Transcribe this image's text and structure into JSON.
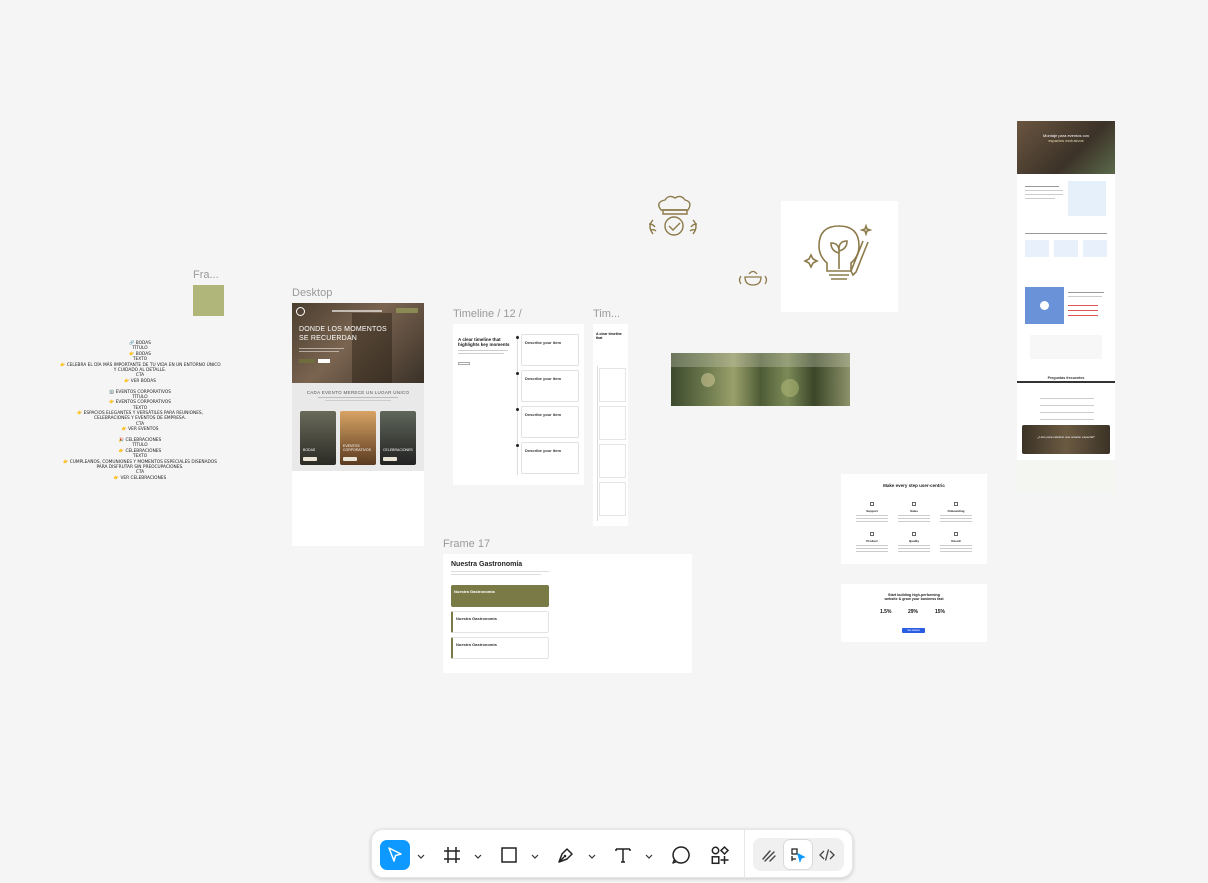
{
  "frames": {
    "small_frame_label": "Fra...",
    "desktop_label": "Desktop",
    "timeline_label": "Timeline / 12 /",
    "timeline_small_label": "Tim...",
    "frame17_label": "Frame 17"
  },
  "outline_text": [
    "🔗 BODAS",
    "TÍTULO",
    "👉 BODAS",
    "TEXTO",
    "👉 CELEBRA EL DÍA MÁS IMPORTANTE DE TU VIDA EN UN ENTORNO ÚNICO",
    "Y CUIDADO AL DETALLE.",
    "CTA",
    "👉 VER BODAS",
    "",
    "🏢 EVENTOS CORPORATIVOS",
    "TÍTULO",
    "👉 EVENTOS CORPORATIVOS",
    "TEXTO",
    "👉 ESPACIOS ELEGANTES Y VERSÁTILES PARA REUNIONES,",
    "CELEBRACIONES Y EVENTOS DE EMPRESA.",
    "CTA",
    "👉 VER EVENTOS",
    "",
    "🎉 CELEBRACIONES",
    "TÍTULO",
    "👉 CELEBRACIONES",
    "TEXTO",
    "👉 CUMPLEAÑOS, COMUNIONES Y MOMENTOS ESPECIALES DISEÑADOS",
    "PARA DISFRUTAR SIN PREOCUPACIONES.",
    "CTA",
    "👉 VER CELEBRACIONES"
  ],
  "desktop": {
    "hero_title_line1": "DONDE LOS MOMENTOS",
    "hero_title_line2": "SE RECUERDAN",
    "section_title": "CADA EVENTO MERECE UN LUGAR ÚNICO",
    "cards": [
      {
        "label": "BODAS"
      },
      {
        "label": "EVENTOS CORPORATIVOS"
      },
      {
        "label": "CELEBRACIONES"
      }
    ]
  },
  "timeline": {
    "heading_line1": "A clear timeline that",
    "heading_line2": "highlights key moments",
    "items": [
      {
        "title": "Describe your item"
      },
      {
        "title": "Describe your item"
      },
      {
        "title": "Describe your item"
      },
      {
        "title": "Describe your item"
      }
    ]
  },
  "gastronomia": {
    "title": "Nuestra Gastronomía",
    "cards": [
      {
        "title": "Nuestra Gastronomía"
      },
      {
        "title": "Nuestra Gastronomía"
      },
      {
        "title": "Nuestra Gastronomía"
      }
    ]
  },
  "user_centric": {
    "title": "Make every step user-centric",
    "items": [
      "Support",
      "Sales",
      "Onboarding",
      "Product",
      "Quality",
      "Result"
    ]
  },
  "stats": {
    "title_line1": "Start building high-performing",
    "title_line2": "website & grow your business fast",
    "values": [
      "1.5%",
      "29%",
      "15%"
    ],
    "cta": "Get started"
  },
  "landing": {
    "hero_line1": "Montaje para eventos con",
    "hero_line2": "espacios exclusivos",
    "faq_title": "Preguntas frecuentes",
    "banner_text": "¿Listo para celebrar una ocasión especial?"
  },
  "toolbar": {
    "tools": [
      "move-tool",
      "frame-tool",
      "shape-tool",
      "pen-tool",
      "text-tool",
      "comment-tool",
      "actions-tool"
    ],
    "modes": [
      "draw-mode",
      "design-mode",
      "dev-mode"
    ]
  },
  "colors": {
    "canvas": "#f5f5f5",
    "accent": "#0d99ff",
    "olive": "#7a7a46",
    "swatch": "#b0b57a",
    "gold": "#8c7a4a"
  }
}
